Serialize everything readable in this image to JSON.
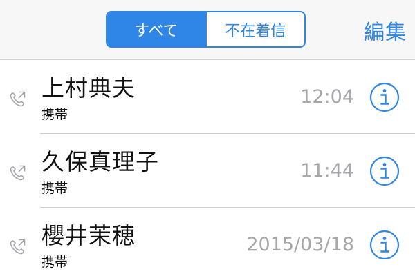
{
  "header": {
    "segments": [
      {
        "label": "すべて",
        "selected": true
      },
      {
        "label": "不在着信",
        "selected": false
      }
    ],
    "edit_label": "編集"
  },
  "calls": [
    {
      "name": "上村典夫",
      "label": "携帯",
      "time": "12:04"
    },
    {
      "name": "久保真理子",
      "label": "携帯",
      "time": "11:44"
    },
    {
      "name": "櫻井茉穂",
      "label": "携帯",
      "time": "2015/03/18"
    }
  ],
  "colors": {
    "accent": "#2f86e6",
    "secondary_text": "#a6a6ab",
    "call_icon": "#a6a6ab"
  },
  "icons": {
    "call_type": "outgoing-call-icon",
    "info": "info-circle-icon"
  }
}
